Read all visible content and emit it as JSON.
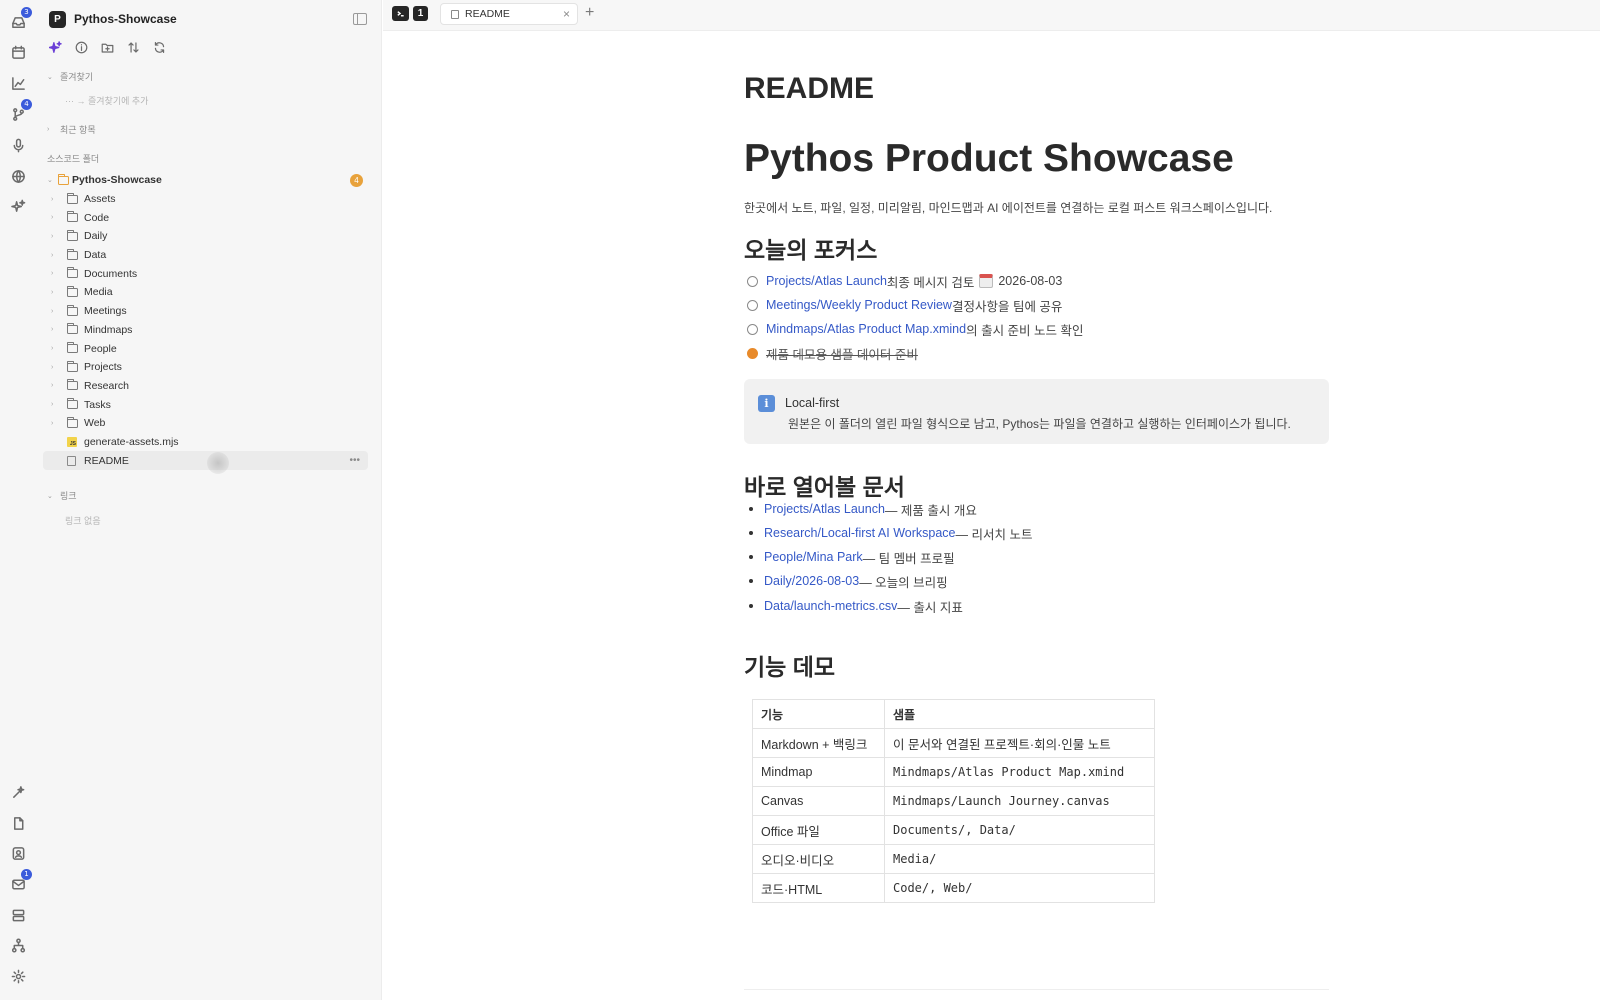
{
  "rail": {
    "top_items": [
      {
        "icon": "inbox-icon",
        "badge": "3"
      },
      {
        "icon": "calendar-icon",
        "badge": ""
      },
      {
        "icon": "chart-icon",
        "badge": ""
      },
      {
        "icon": "git-branch-icon",
        "badge": "4"
      },
      {
        "icon": "microphone-icon",
        "badge": ""
      },
      {
        "icon": "globe-icon",
        "badge": ""
      },
      {
        "icon": "sparkle-icon",
        "badge": ""
      }
    ],
    "bottom_items": [
      {
        "icon": "magic-icon",
        "badge": ""
      },
      {
        "icon": "file-icon",
        "badge": ""
      },
      {
        "icon": "contact-icon",
        "badge": ""
      },
      {
        "icon": "mail-icon",
        "badge": "1"
      },
      {
        "icon": "stack-icon",
        "badge": ""
      },
      {
        "icon": "hierarchy-icon",
        "badge": ""
      },
      {
        "icon": "gear-icon",
        "badge": ""
      }
    ],
    "badge_color": "#3b5bdb"
  },
  "sidebar": {
    "workspace_initial": "P",
    "workspace_name": "Pythos-Showcase",
    "favorites_label": "즐겨찾기",
    "favorites_add": "··· → 즐겨찾기에 추가",
    "recent_label": "최근 항목",
    "source_folder_label": "소스코드 폴더",
    "root_folder": "Pythos-Showcase",
    "root_badge": "4",
    "folders": [
      "Assets",
      "Code",
      "Daily",
      "Data",
      "Documents",
      "Media",
      "Meetings",
      "Mindmaps",
      "People",
      "Projects",
      "Research",
      "Tasks",
      "Web"
    ],
    "files": [
      {
        "name": "generate-assets.mjs",
        "type": "js"
      },
      {
        "name": "README",
        "type": "doc",
        "active": true
      }
    ],
    "links_label": "링크",
    "links_empty": "링크 없음"
  },
  "tabbar": {
    "tab_count": "1",
    "active_tab": "README"
  },
  "doc": {
    "file_title": "README",
    "title": "Pythos Product Showcase",
    "intro": "한곳에서 노트, 파일, 일정, 미리알림, 마인드맵과 AI 에이전트를 연결하는 로컬 퍼스트 워크스페이스입니다.",
    "focus_heading": "오늘의 포커스",
    "tasks": [
      {
        "link": "Projects/Atlas Launch",
        "text": " 최종 메시지 검토",
        "date": "2026-08-03",
        "done": false
      },
      {
        "link": "Meetings/Weekly Product Review",
        "text": " 결정사항을 팀에 공유",
        "date": "",
        "done": false
      },
      {
        "link": "Mindmaps/Atlas Product Map.xmind",
        "text": "의 출시 준비 노드 확인",
        "date": "",
        "done": false
      },
      {
        "link": "",
        "text": "제품 데모용 샘플 데이터 준비",
        "date": "",
        "done": true
      }
    ],
    "callout_title": "Local-first",
    "callout_body": "원본은 이 폴더의 열린 파일 형식으로 남고, Pythos는 파일을 연결하고 실행하는 인터페이스가 됩니다.",
    "quick_heading": "바로 열어볼 문서",
    "quick_links": [
      {
        "link": "Projects/Atlas Launch",
        "desc": " — 제품 출시 개요"
      },
      {
        "link": "Research/Local-first AI Workspace",
        "desc": " — 리서치 노트"
      },
      {
        "link": "People/Mina Park",
        "desc": " — 팀 멤버 프로필"
      },
      {
        "link": "Daily/2026-08-03",
        "desc": " — 오늘의 브리핑"
      },
      {
        "link": "Data/launch-metrics.csv",
        "desc": " — 출시 지표"
      }
    ],
    "features_heading": "기능 데모",
    "table_headers": [
      "기능",
      "샘플"
    ],
    "table_rows": [
      [
        "Markdown + 백링크",
        "이 문서와 연결된 프로젝트·회의·인물 노트"
      ],
      [
        "Mindmap",
        "Mindmaps/Atlas Product Map.xmind"
      ],
      [
        "Canvas",
        "Mindmaps/Launch Journey.canvas"
      ],
      [
        "Office 파일",
        "Documents/, Data/"
      ],
      [
        "오디오·비디오",
        "Media/"
      ],
      [
        "코드·HTML",
        "Code/, Web/"
      ]
    ]
  }
}
